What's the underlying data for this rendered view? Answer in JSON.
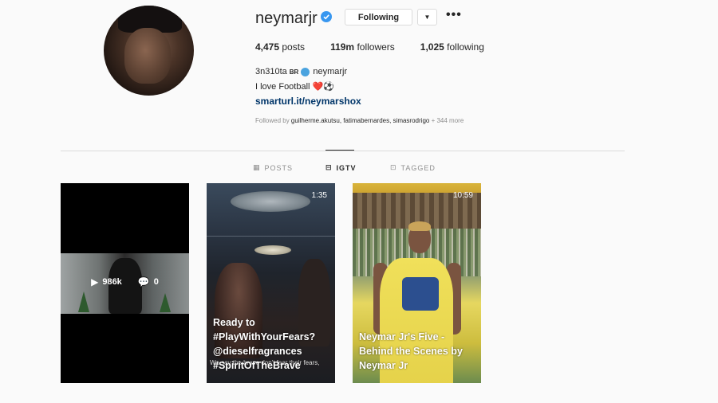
{
  "profile": {
    "username": "neymarjr",
    "follow_button": "Following",
    "more": "•••",
    "stats": {
      "posts_count": "4,475",
      "posts_label": "posts",
      "followers_count": "119m",
      "followers_label": "followers",
      "following_count": "1,025",
      "following_label": "following"
    },
    "bio": {
      "name_prefix": "3n310ta",
      "country": "BR",
      "name_suffix": "neymarjr",
      "line": "I love Football ❤️⚽",
      "link": "smarturl.it/neymarshox"
    },
    "followed_by_prefix": "Followed by",
    "followed_by_names": "guilherme.akutsu, fatimabernardes, simasrodrigo",
    "followed_by_more": "+ 344 more"
  },
  "tabs": [
    {
      "label": "POSTS",
      "icon": "grid-icon",
      "active": false
    },
    {
      "label": "IGTV",
      "icon": "igtv-icon",
      "active": true
    },
    {
      "label": "TAGGED",
      "icon": "tag-icon",
      "active": false
    }
  ],
  "videos": [
    {
      "views": "986k",
      "comments": "0"
    },
    {
      "duration": "1:35",
      "title": "Ready to #PlayWithYourFears? @dieselfragrances #SpiritOfTheBrave",
      "subtitle": "We say the brave don't fear their fears,"
    },
    {
      "duration": "10:59",
      "title": "Neymar Jr's Five - Behind the Scenes by Neymar Jr"
    }
  ],
  "colors": {
    "background": "#fafafa",
    "link": "#003569",
    "muted": "#8e8e8e",
    "verified": "#3897f0"
  }
}
